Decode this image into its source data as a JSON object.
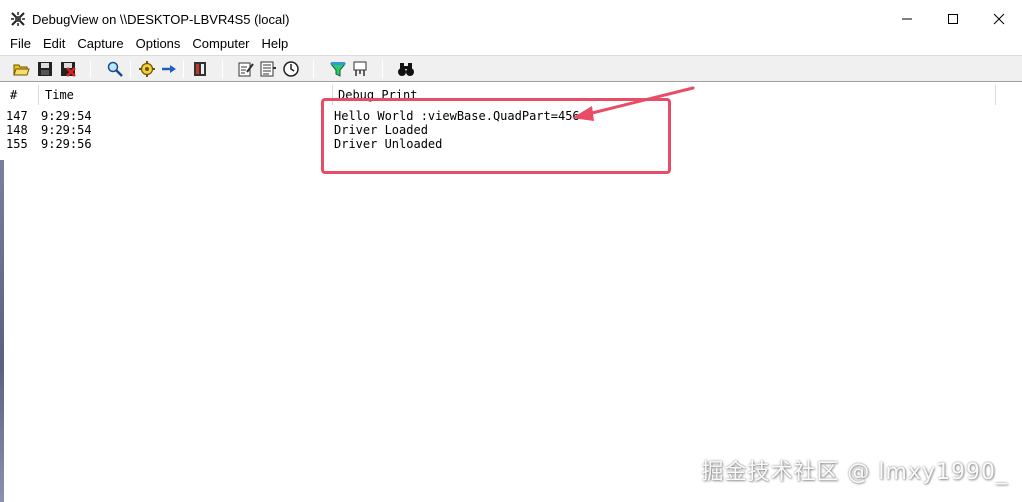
{
  "window": {
    "title": "DebugView on \\\\DESKTOP-LBVR4S5 (local)",
    "controls": {
      "minimize_icon": "minimize-icon",
      "maximize_icon": "maximize-icon",
      "close_icon": "close-icon"
    }
  },
  "menu": {
    "items": [
      "File",
      "Edit",
      "Capture",
      "Options",
      "Computer",
      "Help"
    ]
  },
  "toolbar": {
    "icons": [
      "open-icon",
      "save-icon",
      "clear-display-icon",
      "find-icon",
      "capture-gear-icon",
      "autoscroll-icon",
      "capture-kernel-icon",
      "filter-icon",
      "history-icon",
      "clock-icon",
      "highlight-icon",
      "event-filter-icon",
      "search-binoculars-icon"
    ]
  },
  "list": {
    "columns": {
      "number": "#",
      "time": "Time",
      "debug_print": "Debug Print"
    },
    "rows": [
      {
        "number": "147",
        "time": "9:29:54",
        "message": "Hello World :viewBase.QuadPart=456"
      },
      {
        "number": "148",
        "time": "9:29:54",
        "message": "Driver Loaded"
      },
      {
        "number": "155",
        "time": "9:29:56",
        "message": "Driver Unloaded"
      }
    ]
  },
  "annotation": {
    "color": "#e84d67"
  },
  "watermark": {
    "text": "掘金技术社区 @ lmxy1990_"
  }
}
